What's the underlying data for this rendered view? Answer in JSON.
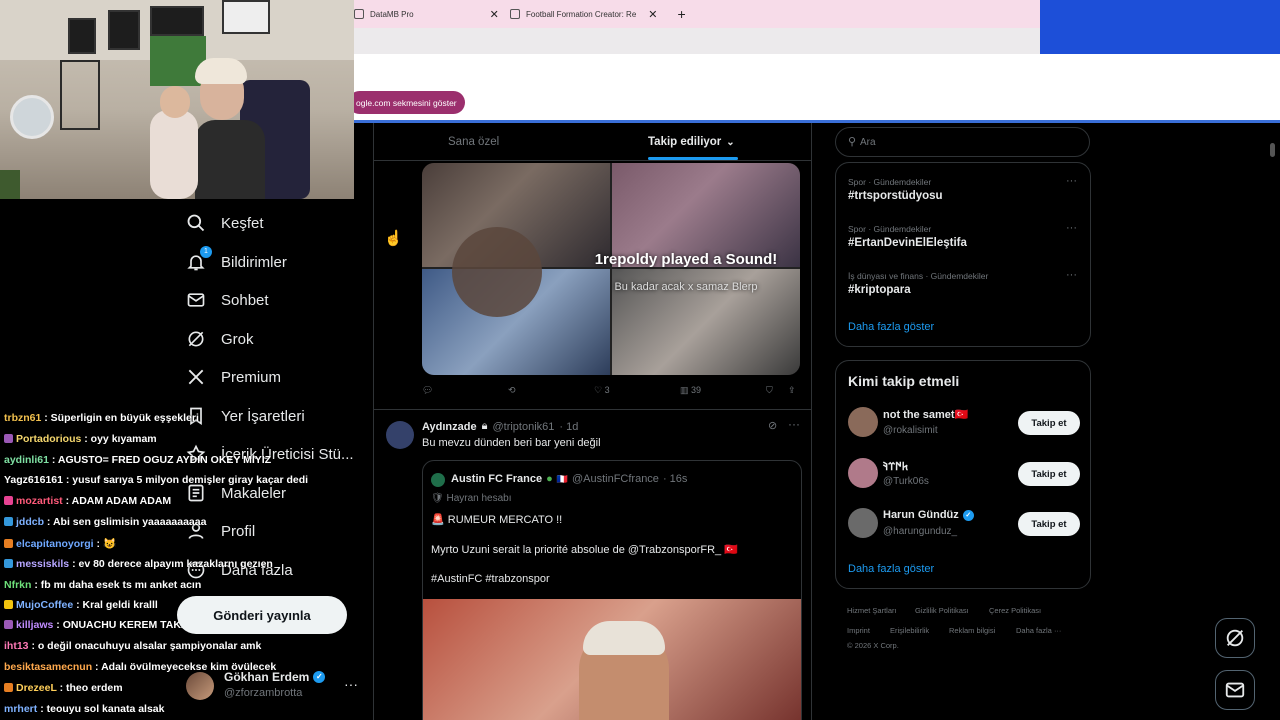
{
  "browser": {
    "tabs": [
      {
        "label": "DataMB Pro"
      },
      {
        "label": "Football Formation Creator: Re"
      }
    ],
    "bookmark_chip": "ogle.com sekmesini göster"
  },
  "nav": {
    "items": [
      {
        "label": "Keşfet",
        "icon": "search-icon"
      },
      {
        "label": "Bildirimler",
        "icon": "bell-icon",
        "badge": "1"
      },
      {
        "label": "Sohbet",
        "icon": "mail-icon"
      },
      {
        "label": "Grok",
        "icon": "grok-icon"
      },
      {
        "label": "Premium",
        "icon": "x-logo-icon"
      },
      {
        "label": "Yer İşaretleri",
        "icon": "bookmark-icon"
      },
      {
        "label": "İçerik Üreticisi Stü...",
        "icon": "creator-studio-icon"
      },
      {
        "label": "Makaleler",
        "icon": "article-icon"
      },
      {
        "label": "Profil",
        "icon": "profile-icon"
      },
      {
        "label": "Daha fazla",
        "icon": "more-circle-icon"
      }
    ],
    "post_button": "Gönderi yayınla",
    "account": {
      "name": "Gökhan Erdem",
      "handle": "@zforzambrotta"
    }
  },
  "chat": [
    {
      "user": "trbzn61",
      "text": ": Süperligin en büyük eşşekleri",
      "color": "#f2c14e",
      "badge": ""
    },
    {
      "user": "Portadorious",
      "text": ": oyy kıyamam",
      "color": "#f5d76e",
      "badge": "#9b59b6"
    },
    {
      "user": "aydinli61",
      "text": ": AGUSTO= FRED OGUZ AYDIN OKEY MIYIZ",
      "color": "#7fe0a3",
      "badge": ""
    },
    {
      "user": "Yagz616161",
      "text": ": yusuf sarıya 5 milyon demişler giray kaçar dedi",
      "color": "#ffffff",
      "badge": ""
    },
    {
      "user": "mozartist",
      "text": ": ADAM ADAM ADAM",
      "color": "#ff5a7a",
      "badge": "#e84393"
    },
    {
      "user": "jddcb",
      "text": ": Abi sen gslimisin yaaaaaaaaaa",
      "color": "#7fb2ff",
      "badge": "#3498db"
    },
    {
      "user": "elcapitanoyorgi",
      "text": ": 😺",
      "color": "#6fa8ff",
      "badge": "#e67e22"
    },
    {
      "user": "messiskils",
      "text": ": ev 80 derece alpayım kazaklarnı gezıen",
      "color": "#b6a6ff",
      "badge": "#3498db"
    },
    {
      "user": "Nfrkn",
      "text": ": fb mı daha esek ts mı anket acın",
      "color": "#6ee07a",
      "badge": ""
    },
    {
      "user": "MujoCoffee",
      "text": ": Kral geldi kralll",
      "color": "#7fb2ff",
      "badge": "#f1c40f"
    },
    {
      "user": "killjaws",
      "text": ": ONUACHU KEREM TAKASI HEMEN",
      "color": "#c08cff",
      "badge": "#9b59b6"
    },
    {
      "user": "iht13",
      "text": ": o değil onacuhuyu alsalar şampiyonalar amk",
      "color": "#ff7ab6",
      "badge": ""
    },
    {
      "user": "besiktasamecnun",
      "text": ": Adalı övülmeyecekse kim övülecek",
      "color": "#ffa94d",
      "badge": ""
    },
    {
      "user": "DrezeeL",
      "text": ": theo erdem",
      "color": "#ffcf5a",
      "badge": "#e67e22"
    },
    {
      "user": "mrhert",
      "text": ": teouyu sol kanata alsak",
      "color": "#7fb2ff",
      "badge": ""
    }
  ],
  "feed": {
    "tabs": {
      "for_you": "Sana özel",
      "following": "Takip ediliyor"
    },
    "media_overlay": {
      "title": "1repoldy played a Sound!",
      "subtitle": "Bu kadar acak x samaz Blerp"
    },
    "tweet1_actions": {
      "likes": "3",
      "views": "39"
    },
    "tweet2": {
      "name": "Aydınzade",
      "handle": "@triptonik61",
      "time": "· 1d",
      "text": "Bu mevzu dünden beri bar yeni değil",
      "quote": {
        "name": "Austin FC France",
        "handle": "@AustinFCfrance",
        "time": "· 16s",
        "account_type": "Hayran hesabı",
        "line1": "🚨 RUMEUR MERCATO !!",
        "line2": "Myrto Uzuni serait la priorité absolue de @TrabzonsporFR_ 🇹🇷",
        "line3": "#AustinFC #trabzonspor"
      }
    }
  },
  "sidebar": {
    "search_placeholder": "Ara",
    "trends": [
      {
        "category": "Spor · Gündemdekiler",
        "tag": "#trtsporstüdyosu"
      },
      {
        "category": "Spor · Gündemdekiler",
        "tag": "#ErtanDevinElEleştifa"
      },
      {
        "category": "İş dünyası ve finans · Gündemdekiler",
        "tag": "#kriptopara"
      }
    ],
    "show_more": "Daha fazla göster",
    "who_to_follow": {
      "title": "Kimi takip etmeli",
      "users": [
        {
          "name": "not the samet🇹🇷",
          "handle": "@rokalisimit"
        },
        {
          "name": "𐱅𐰇𐰼𐰚",
          "handle": "@Turk06s"
        },
        {
          "name": "Harun Gündüz",
          "handle": "@harungunduz_"
        }
      ],
      "follow_label": "Takip et",
      "show_more": "Daha fazla göster"
    },
    "footer": [
      "Hizmet Şartları",
      "Gizlilik Politikası",
      "Çerez Politikası",
      "Imprint",
      "Erişilebilirlik",
      "Reklam bilgisi",
      "Daha fazla ···",
      "© 2026 X Corp."
    ]
  }
}
